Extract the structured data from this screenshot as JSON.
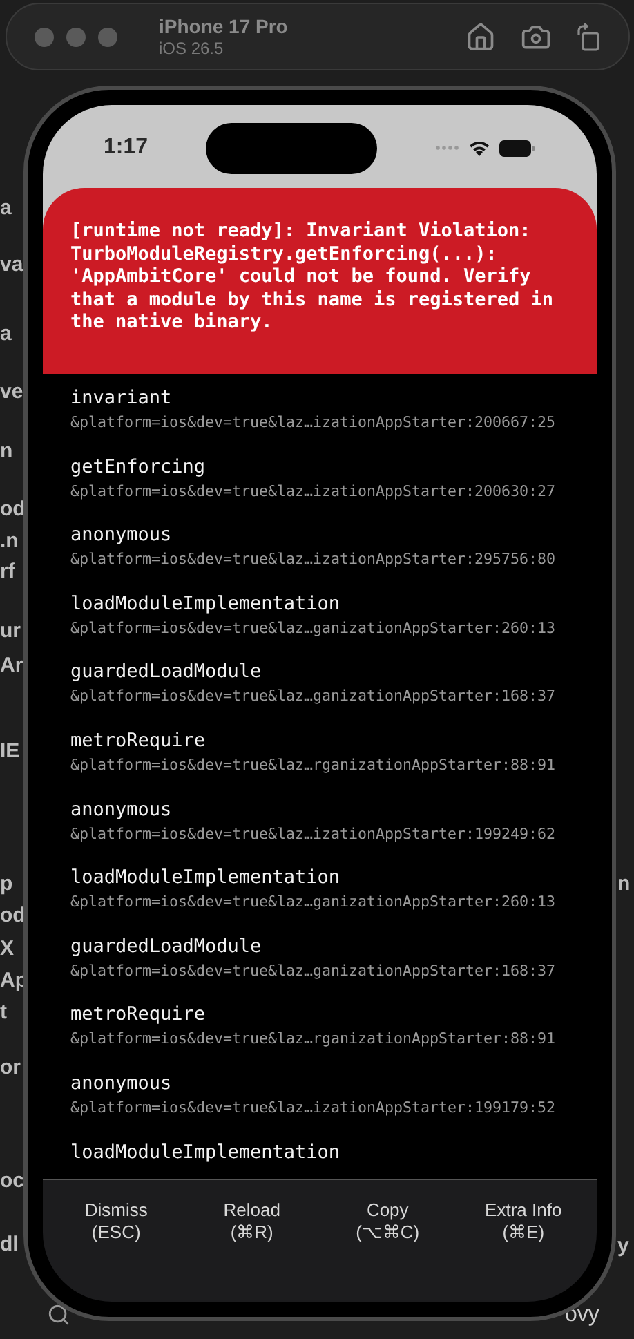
{
  "window": {
    "title": "iPhone 17 Pro",
    "subtitle": "iOS 26.5"
  },
  "background": {
    "left_fragments": [
      "a",
      "va",
      "a",
      "ve",
      "n",
      "od",
      ".n",
      "rf",
      "ur",
      "Ar",
      "IE",
      "p",
      "od",
      "X",
      "Ap",
      "t",
      "or",
      "oc",
      "dl"
    ],
    "right_fragments": [
      "n",
      "y"
    ],
    "bottom_text": "ovy"
  },
  "status_bar": {
    "time": "1:17"
  },
  "error": {
    "message": "[runtime not ready]: Invariant Violation: TurboModuleRegistry.getEnforcing(...): 'AppAmbitCore' could not be found. Verify that a module by this name is registered in the native binary."
  },
  "stack": [
    {
      "name": "invariant",
      "location": "&platform=ios&dev=true&laz…izationAppStarter:200667:25"
    },
    {
      "name": "getEnforcing",
      "location": "&platform=ios&dev=true&laz…izationAppStarter:200630:27"
    },
    {
      "name": "anonymous",
      "location": "&platform=ios&dev=true&laz…izationAppStarter:295756:80"
    },
    {
      "name": "loadModuleImplementation",
      "location": "&platform=ios&dev=true&laz…ganizationAppStarter:260:13"
    },
    {
      "name": "guardedLoadModule",
      "location": "&platform=ios&dev=true&laz…ganizationAppStarter:168:37"
    },
    {
      "name": "metroRequire",
      "location": "&platform=ios&dev=true&laz…rganizationAppStarter:88:91"
    },
    {
      "name": "anonymous",
      "location": "&platform=ios&dev=true&laz…izationAppStarter:199249:62"
    },
    {
      "name": "loadModuleImplementation",
      "location": "&platform=ios&dev=true&laz…ganizationAppStarter:260:13"
    },
    {
      "name": "guardedLoadModule",
      "location": "&platform=ios&dev=true&laz…ganizationAppStarter:168:37"
    },
    {
      "name": "metroRequire",
      "location": "&platform=ios&dev=true&laz…rganizationAppStarter:88:91"
    },
    {
      "name": "anonymous",
      "location": "&platform=ios&dev=true&laz…izationAppStarter:199179:52"
    },
    {
      "name": "loadModuleImplementation"
    }
  ],
  "buttons": [
    {
      "label": "Dismiss",
      "shortcut": "(ESC)"
    },
    {
      "label": "Reload",
      "shortcut": "(⌘R)"
    },
    {
      "label": "Copy",
      "shortcut": "(⌥⌘C)"
    },
    {
      "label": "Extra Info",
      "shortcut": "(⌘E)"
    }
  ]
}
